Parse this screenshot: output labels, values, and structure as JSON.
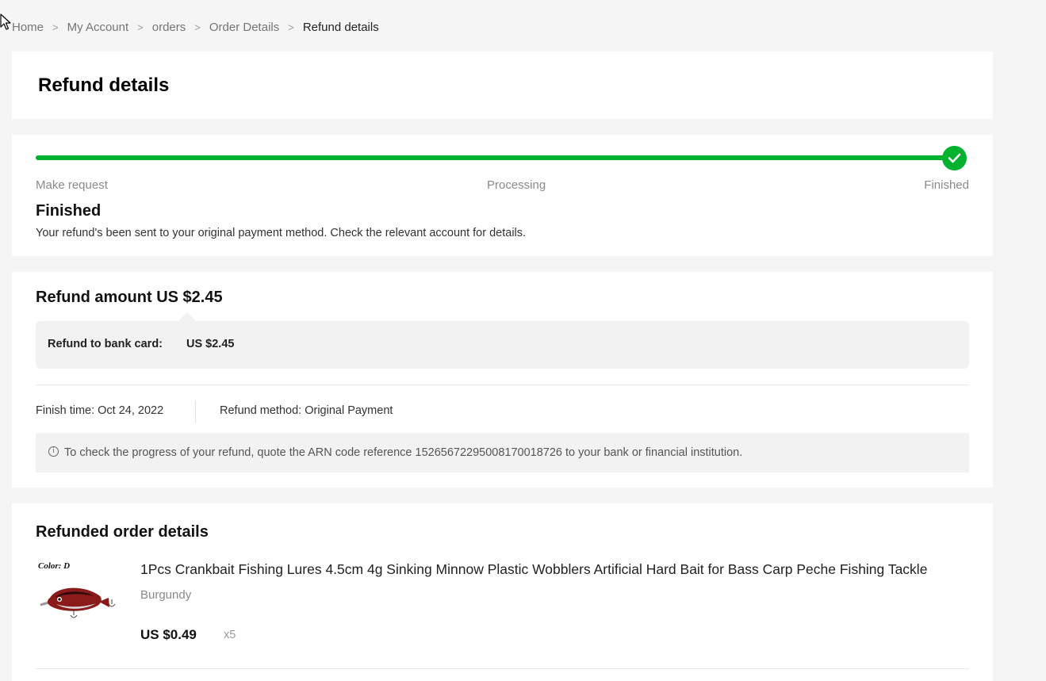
{
  "breadcrumb": {
    "items": [
      "Home",
      "My Account",
      "orders",
      "Order Details"
    ],
    "current": "Refund details",
    "separator": ">"
  },
  "page": {
    "title": "Refund details"
  },
  "progress": {
    "steps": [
      "Make request",
      "Processing",
      "Finished"
    ],
    "completed_fraction": 1.0,
    "status_title": "Finished",
    "status_description": "Your refund's been sent to your original payment method. Check the relevant account for details.",
    "accent_color": "#00b22d",
    "icon": "check-icon"
  },
  "refund": {
    "heading": "Refund amount US $2.45",
    "to_label": "Refund to bank card:",
    "to_value": "US $2.45",
    "finish_time": "Finish time: Oct 24, 2022",
    "method": "Refund method: Original Payment",
    "arn_info_icon": "info-icon",
    "arn_text": "To check the progress of your refund, quote the ARN code reference 15265672295008170018726 to your bank or financial institution."
  },
  "order": {
    "heading": "Refunded order details",
    "product": {
      "image_label": "Color: D",
      "name": "1Pcs Crankbait Fishing Lures 4.5cm 4g Sinking Minnow Plastic Wobblers Artificial Hard Bait for Bass Carp Peche Fishing Tackle",
      "variant": "Burgundy",
      "price": "US $0.49",
      "quantity": "x5"
    }
  }
}
